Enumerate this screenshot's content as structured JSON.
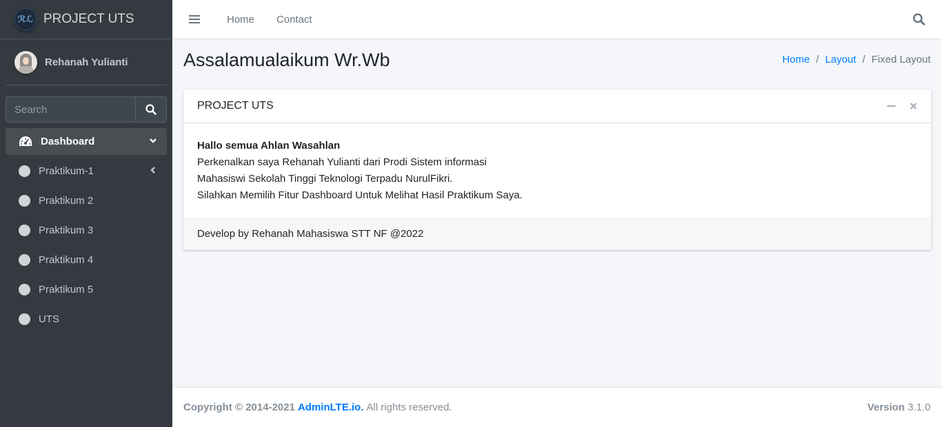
{
  "brand": {
    "logo_text": "ℛℒ",
    "name": "PROJECT UTS"
  },
  "user": {
    "name": "Rehanah Yulianti"
  },
  "search": {
    "placeholder": "Search"
  },
  "nav": {
    "items": [
      {
        "label": "Dashboard",
        "icon": "tachometer-icon",
        "active": true,
        "arrow": "chevron-down"
      },
      {
        "label": "Praktikum-1",
        "icon": "circle-icon",
        "arrow": "chevron-left"
      },
      {
        "label": "Praktikum 2",
        "icon": "circle-icon"
      },
      {
        "label": "Praktikum 3",
        "icon": "circle-icon"
      },
      {
        "label": "Praktikum 4",
        "icon": "circle-icon"
      },
      {
        "label": "Praktikum 5",
        "icon": "circle-icon"
      },
      {
        "label": "UTS",
        "icon": "circle-icon"
      }
    ]
  },
  "topbar": {
    "home": "Home",
    "contact": "Contact"
  },
  "header": {
    "title": "Assalamualaikum Wr.Wb"
  },
  "breadcrumb": {
    "home": "Home",
    "layout": "Layout",
    "current": "Fixed Layout",
    "separator": "/"
  },
  "card": {
    "title": "PROJECT UTS",
    "greeting": "Hallo semua Ahlan Wasahlan",
    "lines": [
      "Perkenalkan saya Rehanah Yulianti dari Prodi Sistem informasi",
      "Mahasiswi Sekolah Tinggi Teknologi Terpadu NurulFikri.",
      "Silahkan Memilih Fitur Dashboard Untuk Melihat Hasil Praktikum Saya."
    ],
    "footer": "Develop by Rehanah Mahasiswa STT NF @2022"
  },
  "footer": {
    "copyright": "Copyright © 2014-2021",
    "brand": "AdminLTE.io.",
    "rights": "All rights reserved.",
    "version_label": "Version",
    "version": "3.1.0"
  },
  "colors": {
    "sidebar": "#343a40",
    "accent": "#007bff",
    "background": "#f4f6f9"
  }
}
